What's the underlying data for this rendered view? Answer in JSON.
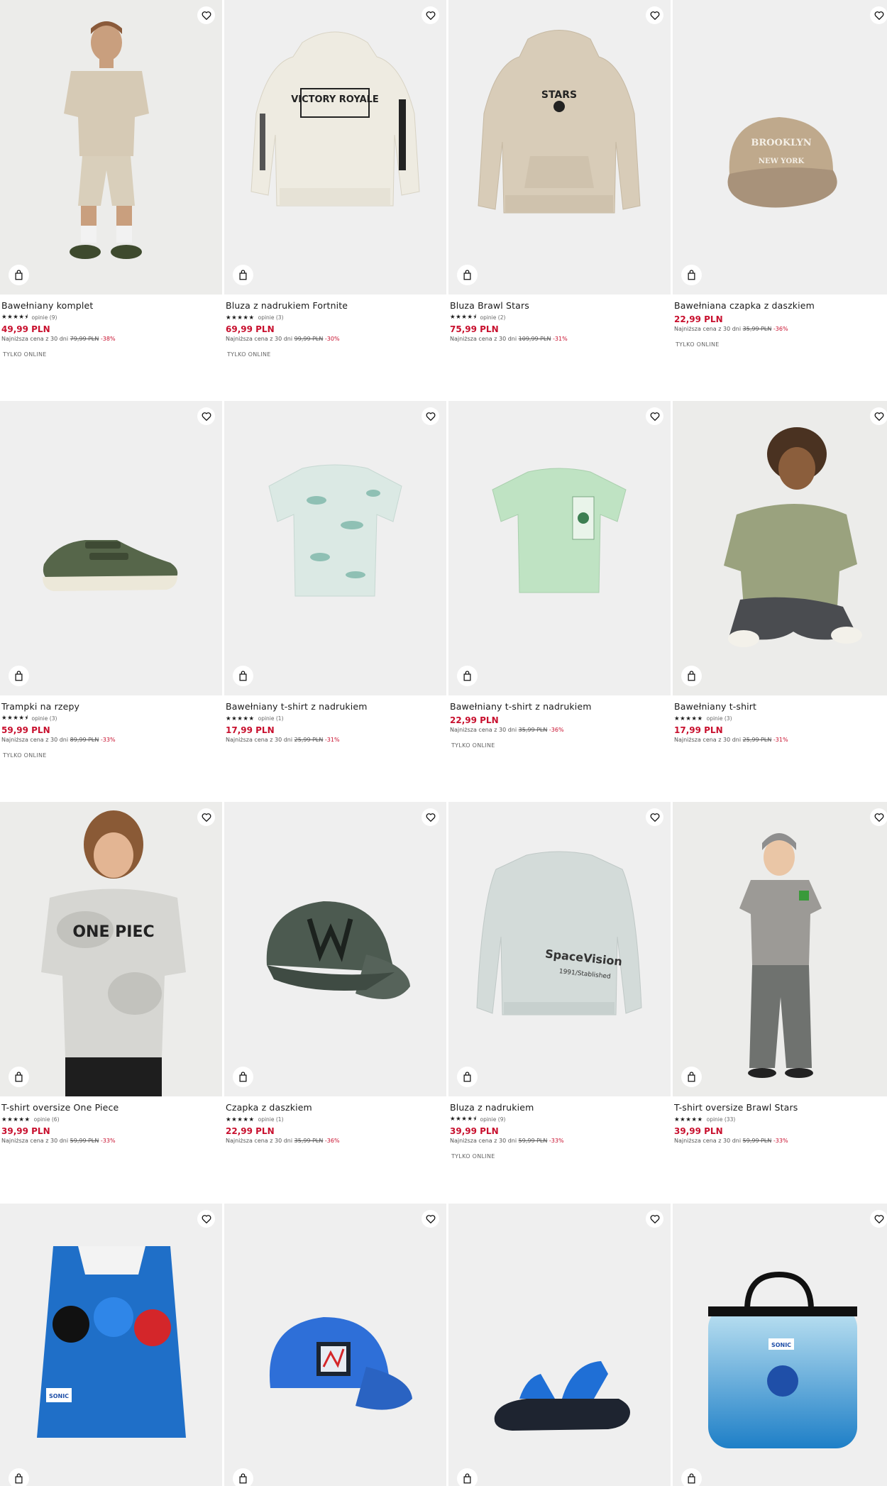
{
  "products": [
    {
      "name": "Bawełniany komplet",
      "stars": "★★★★⯨",
      "reviews": "opinie (9)",
      "price": "49,99 PLN",
      "lowest_label": "Najniższa cena z 30 dni",
      "old_price": "79,99 PLN",
      "discount": "-38%",
      "badge": "TYLKO ONLINE"
    },
    {
      "name": "Bluza z nadrukiem Fortnite",
      "stars": "★★★★★",
      "reviews": "opinie (3)",
      "price": "69,99 PLN",
      "lowest_label": "Najniższa cena z 30 dni",
      "old_price": "99,99 PLN",
      "discount": "-30%",
      "badge": "TYLKO ONLINE"
    },
    {
      "name": "Bluza Brawl Stars",
      "stars": "★★★★⯨",
      "reviews": "opinie (2)",
      "price": "75,99 PLN",
      "lowest_label": "Najniższa cena z 30 dni",
      "old_price": "109,99 PLN",
      "discount": "-31%",
      "badge": ""
    },
    {
      "name": "Bawełniana czapka z daszkiem",
      "stars": "",
      "reviews": "",
      "price": "22,99 PLN",
      "lowest_label": "Najniższa cena z 30 dni",
      "old_price": "35,99 PLN",
      "discount": "-36%",
      "badge": "TYLKO ONLINE"
    },
    {
      "name": "Trampki na rzepy",
      "stars": "★★★★⯨",
      "reviews": "opinie (3)",
      "price": "59,99 PLN",
      "lowest_label": "Najniższa cena z 30 dni",
      "old_price": "89,99 PLN",
      "discount": "-33%",
      "badge": "TYLKO ONLINE"
    },
    {
      "name": "Bawełniany t-shirt z nadrukiem",
      "stars": "★★★★★",
      "reviews": "opinie (1)",
      "price": "17,99 PLN",
      "lowest_label": "Najniższa cena z 30 dni",
      "old_price": "25,99 PLN",
      "discount": "-31%",
      "badge": ""
    },
    {
      "name": "Bawełniany t-shirt z nadrukiem",
      "stars": "",
      "reviews": "",
      "price": "22,99 PLN",
      "lowest_label": "Najniższa cena z 30 dni",
      "old_price": "35,99 PLN",
      "discount": "-36%",
      "badge": "TYLKO ONLINE"
    },
    {
      "name": "Bawełniany t-shirt",
      "stars": "★★★★★",
      "reviews": "opinie (3)",
      "price": "17,99 PLN",
      "lowest_label": "Najniższa cena z 30 dni",
      "old_price": "25,99 PLN",
      "discount": "-31%",
      "badge": ""
    },
    {
      "name": "T-shirt oversize One Piece",
      "stars": "★★★★★",
      "reviews": "opinie (6)",
      "price": "39,99 PLN",
      "lowest_label": "Najniższa cena z 30 dni",
      "old_price": "59,99 PLN",
      "discount": "-33%",
      "badge": ""
    },
    {
      "name": "Czapka z daszkiem",
      "stars": "★★★★★",
      "reviews": "opinie (1)",
      "price": "22,99 PLN",
      "lowest_label": "Najniższa cena z 30 dni",
      "old_price": "35,99 PLN",
      "discount": "-36%",
      "badge": ""
    },
    {
      "name": "Bluza z nadrukiem",
      "stars": "★★★★⯨",
      "reviews": "opinie (9)",
      "price": "39,99 PLN",
      "lowest_label": "Najniższa cena z 30 dni",
      "old_price": "59,99 PLN",
      "discount": "-33%",
      "badge": "TYLKO ONLINE"
    },
    {
      "name": "T-shirt oversize Brawl Stars",
      "stars": "★★★★★",
      "reviews": "opinie (33)",
      "price": "39,99 PLN",
      "lowest_label": "Najniższa cena z 30 dni",
      "old_price": "59,99 PLN",
      "discount": "-33%",
      "badge": ""
    },
    {
      "name": "",
      "stars": "",
      "reviews": "",
      "price": "",
      "lowest_label": "",
      "old_price": "",
      "discount": "",
      "badge": ""
    },
    {
      "name": "",
      "stars": "",
      "reviews": "",
      "price": "",
      "lowest_label": "",
      "old_price": "",
      "discount": "",
      "badge": ""
    },
    {
      "name": "",
      "stars": "",
      "reviews": "",
      "price": "",
      "lowest_label": "",
      "old_price": "",
      "discount": "",
      "badge": ""
    },
    {
      "name": "",
      "stars": "",
      "reviews": "",
      "price": "",
      "lowest_label": "",
      "old_price": "",
      "discount": "",
      "badge": ""
    }
  ],
  "image_text": {
    "fortnite_print": "VICTORY ROYALE",
    "brawl_print": "STARS",
    "cap_print_1": "BROOKLYN",
    "cap_print_2": "NEW YORK",
    "one_piece_print": "ONE PIEC",
    "spacevision_print": "SpaceVision",
    "spacevision_sub": "1991/Stablished",
    "sonic_badge": "SONIC"
  },
  "icons": {
    "favorite": "heart-icon",
    "cart": "shopping-bag-icon"
  }
}
